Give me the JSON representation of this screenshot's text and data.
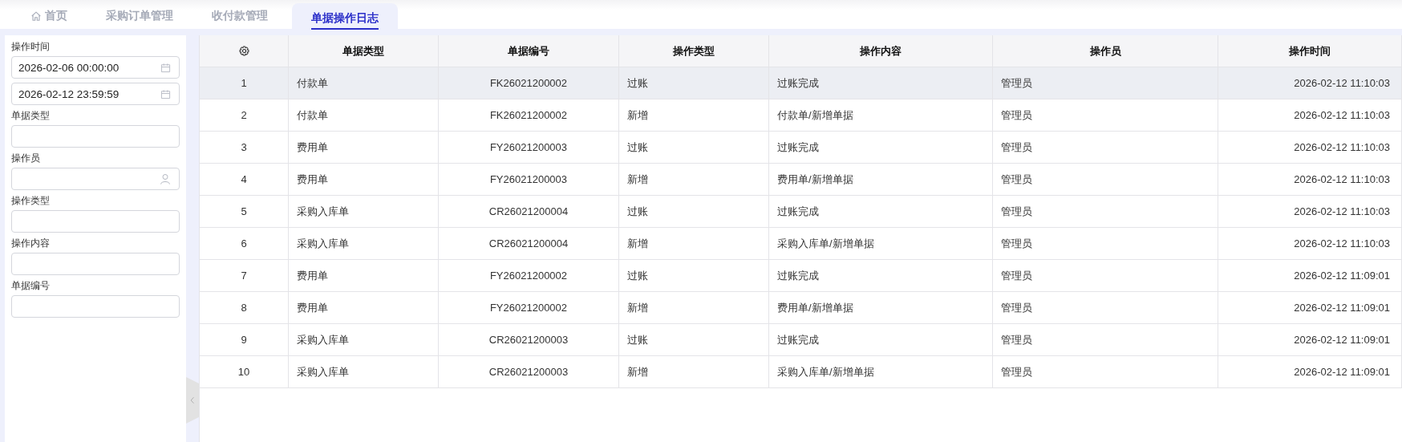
{
  "tabs": [
    {
      "label": "首页",
      "kind": "home",
      "selected": false
    },
    {
      "label": "采购订单管理",
      "kind": "plain",
      "selected": false
    },
    {
      "label": "收付款管理",
      "kind": "plain",
      "selected": false
    },
    {
      "label": "单据操作日志",
      "kind": "plain",
      "selected": true
    }
  ],
  "filters": [
    {
      "label": "操作时间",
      "fields": [
        {
          "kind": "date",
          "value": "2026-02-06 00:00:00"
        },
        {
          "kind": "date",
          "value": "2026-02-12 23:59:59"
        }
      ]
    },
    {
      "label": "单据类型",
      "fields": [
        {
          "kind": "text"
        }
      ]
    },
    {
      "label": "操作员",
      "fields": [
        {
          "kind": "user"
        }
      ]
    },
    {
      "label": "操作类型",
      "fields": [
        {
          "kind": "text"
        }
      ]
    },
    {
      "label": "操作内容",
      "fields": [
        {
          "kind": "text"
        }
      ]
    },
    {
      "label": "单据编号",
      "fields": [
        {
          "kind": "text"
        }
      ]
    }
  ],
  "table": {
    "columns": [
      {
        "label": "单据类型"
      },
      {
        "label": "单据编号"
      },
      {
        "label": "操作类型"
      },
      {
        "label": "操作内容"
      },
      {
        "label": "操作员"
      },
      {
        "label": "操作时间"
      }
    ],
    "rows": [
      {
        "index": "1",
        "selected": true,
        "cells": [
          "付款单",
          "FK26021200002",
          "过账",
          "过账完成",
          "管理员",
          "2026-02-12 11:10:03"
        ]
      },
      {
        "index": "2",
        "selected": false,
        "cells": [
          "付款单",
          "FK26021200002",
          "新增",
          "付款单/新增单据",
          "管理员",
          "2026-02-12 11:10:03"
        ]
      },
      {
        "index": "3",
        "selected": false,
        "cells": [
          "费用单",
          "FY26021200003",
          "过账",
          "过账完成",
          "管理员",
          "2026-02-12 11:10:03"
        ]
      },
      {
        "index": "4",
        "selected": false,
        "cells": [
          "费用单",
          "FY26021200003",
          "新增",
          "费用单/新增单据",
          "管理员",
          "2026-02-12 11:10:03"
        ]
      },
      {
        "index": "5",
        "selected": false,
        "cells": [
          "采购入库单",
          "CR26021200004",
          "过账",
          "过账完成",
          "管理员",
          "2026-02-12 11:10:03"
        ]
      },
      {
        "index": "6",
        "selected": false,
        "cells": [
          "采购入库单",
          "CR26021200004",
          "新增",
          "采购入库单/新增单据",
          "管理员",
          "2026-02-12 11:10:03"
        ]
      },
      {
        "index": "7",
        "selected": false,
        "cells": [
          "费用单",
          "FY26021200002",
          "过账",
          "过账完成",
          "管理员",
          "2026-02-12 11:09:01"
        ]
      },
      {
        "index": "8",
        "selected": false,
        "cells": [
          "费用单",
          "FY26021200002",
          "新增",
          "费用单/新增单据",
          "管理员",
          "2026-02-12 11:09:01"
        ]
      },
      {
        "index": "9",
        "selected": false,
        "cells": [
          "采购入库单",
          "CR26021200003",
          "过账",
          "过账完成",
          "管理员",
          "2026-02-12 11:09:01"
        ]
      },
      {
        "index": "10",
        "selected": false,
        "cells": [
          "采购入库单",
          "CR26021200003",
          "新增",
          "采购入库单/新增单据",
          "管理员",
          "2026-02-12 11:09:01"
        ]
      }
    ]
  }
}
